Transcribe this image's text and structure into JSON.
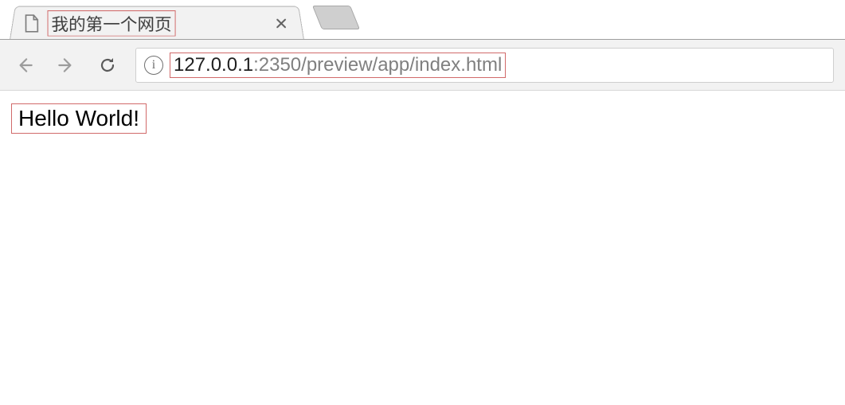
{
  "tab": {
    "title": "我的第一个网页"
  },
  "address": {
    "host": "127.0.0.1",
    "rest": ":2350/preview/app/index.html"
  },
  "page": {
    "body_text": "Hello World!"
  }
}
